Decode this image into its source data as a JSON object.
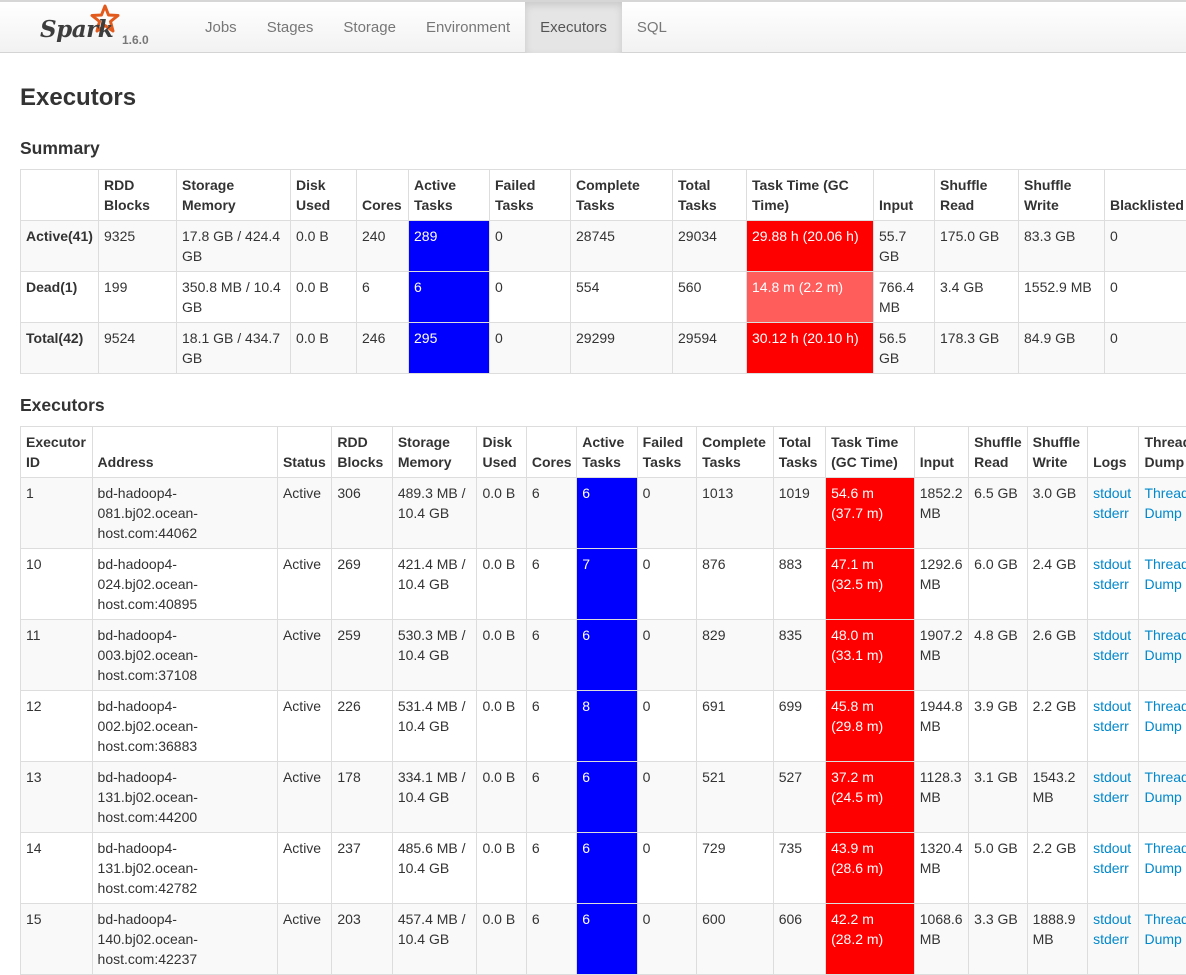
{
  "app": {
    "logo_text": "Spark",
    "version": "1.6.0",
    "star_color": "#e25a1c"
  },
  "nav": {
    "tabs": [
      "Jobs",
      "Stages",
      "Storage",
      "Environment",
      "Executors",
      "SQL"
    ],
    "active": "Executors"
  },
  "page": {
    "title": "Executors"
  },
  "summary": {
    "title": "Summary",
    "headers": [
      "",
      "RDD Blocks",
      "Storage Memory",
      "Disk Used",
      "Cores",
      "Active Tasks",
      "Failed Tasks",
      "Complete Tasks",
      "Total Tasks",
      "Task Time (GC Time)",
      "Input",
      "Shuffle Read",
      "Shuffle Write",
      "Blacklisted"
    ],
    "rows": [
      {
        "label": "Active(41)",
        "rdd_blocks": "9325",
        "storage_memory": "17.8 GB / 424.4 GB",
        "disk_used": "0.0 B",
        "cores": "240",
        "active_tasks": "289",
        "failed_tasks": "0",
        "complete_tasks": "28745",
        "total_tasks": "29034",
        "task_time": "29.88 h (20.06 h)",
        "input": "55.7 GB",
        "shuffle_read": "175.0 GB",
        "shuffle_write": "83.3 GB",
        "blacklisted": "0"
      },
      {
        "label": "Dead(1)",
        "rdd_blocks": "199",
        "storage_memory": "350.8 MB / 10.4 GB",
        "disk_used": "0.0 B",
        "cores": "6",
        "active_tasks": "6",
        "failed_tasks": "0",
        "complete_tasks": "554",
        "total_tasks": "560",
        "task_time": "14.8 m (2.2 m)",
        "input": "766.4 MB",
        "shuffle_read": "3.4 GB",
        "shuffle_write": "1552.9 MB",
        "blacklisted": "0"
      },
      {
        "label": "Total(42)",
        "rdd_blocks": "9524",
        "storage_memory": "18.1 GB / 434.7 GB",
        "disk_used": "0.0 B",
        "cores": "246",
        "active_tasks": "295",
        "failed_tasks": "0",
        "complete_tasks": "29299",
        "total_tasks": "29594",
        "task_time": "30.12 h (20.10 h)",
        "input": "56.5 GB",
        "shuffle_read": "178.3 GB",
        "shuffle_write": "84.9 GB",
        "blacklisted": "0"
      }
    ]
  },
  "executors": {
    "title": "Executors",
    "headers": [
      "Executor ID",
      "Address",
      "Status",
      "RDD Blocks",
      "Storage Memory",
      "Disk Used",
      "Cores",
      "Active Tasks",
      "Failed Tasks",
      "Complete Tasks",
      "Total Tasks",
      "Task Time (GC Time)",
      "Input",
      "Shuffle Read",
      "Shuffle Write",
      "Logs",
      "Thread Dump"
    ],
    "log_labels": [
      "stdout",
      "stderr"
    ],
    "thread_dump_label": "Thread Dump",
    "rows": [
      {
        "id": "1",
        "address": "bd-hadoop4-081.bj02.ocean-host.com:44062",
        "status": "Active",
        "rdd_blocks": "306",
        "storage_memory": "489.3 MB / 10.4 GB",
        "disk_used": "0.0 B",
        "cores": "6",
        "active_tasks": "6",
        "failed_tasks": "0",
        "complete_tasks": "1013",
        "total_tasks": "1019",
        "task_time": "54.6 m (37.7 m)",
        "input": "1852.2 MB",
        "shuffle_read": "6.5 GB",
        "shuffle_write": "3.0 GB"
      },
      {
        "id": "10",
        "address": "bd-hadoop4-024.bj02.ocean-host.com:40895",
        "status": "Active",
        "rdd_blocks": "269",
        "storage_memory": "421.4 MB / 10.4 GB",
        "disk_used": "0.0 B",
        "cores": "6",
        "active_tasks": "7",
        "failed_tasks": "0",
        "complete_tasks": "876",
        "total_tasks": "883",
        "task_time": "47.1 m (32.5 m)",
        "input": "1292.6 MB",
        "shuffle_read": "6.0 GB",
        "shuffle_write": "2.4 GB"
      },
      {
        "id": "11",
        "address": "bd-hadoop4-003.bj02.ocean-host.com:37108",
        "status": "Active",
        "rdd_blocks": "259",
        "storage_memory": "530.3 MB / 10.4 GB",
        "disk_used": "0.0 B",
        "cores": "6",
        "active_tasks": "6",
        "failed_tasks": "0",
        "complete_tasks": "829",
        "total_tasks": "835",
        "task_time": "48.0 m (33.1 m)",
        "input": "1907.2 MB",
        "shuffle_read": "4.8 GB",
        "shuffle_write": "2.6 GB"
      },
      {
        "id": "12",
        "address": "bd-hadoop4-002.bj02.ocean-host.com:36883",
        "status": "Active",
        "rdd_blocks": "226",
        "storage_memory": "531.4 MB / 10.4 GB",
        "disk_used": "0.0 B",
        "cores": "6",
        "active_tasks": "8",
        "failed_tasks": "0",
        "complete_tasks": "691",
        "total_tasks": "699",
        "task_time": "45.8 m (29.8 m)",
        "input": "1944.8 MB",
        "shuffle_read": "3.9 GB",
        "shuffle_write": "2.2 GB"
      },
      {
        "id": "13",
        "address": "bd-hadoop4-131.bj02.ocean-host.com:44200",
        "status": "Active",
        "rdd_blocks": "178",
        "storage_memory": "334.1 MB / 10.4 GB",
        "disk_used": "0.0 B",
        "cores": "6",
        "active_tasks": "6",
        "failed_tasks": "0",
        "complete_tasks": "521",
        "total_tasks": "527",
        "task_time": "37.2 m (24.5 m)",
        "input": "1128.3 MB",
        "shuffle_read": "3.1 GB",
        "shuffle_write": "1543.2 MB"
      },
      {
        "id": "14",
        "address": "bd-hadoop4-131.bj02.ocean-host.com:42782",
        "status": "Active",
        "rdd_blocks": "237",
        "storage_memory": "485.6 MB / 10.4 GB",
        "disk_used": "0.0 B",
        "cores": "6",
        "active_tasks": "6",
        "failed_tasks": "0",
        "complete_tasks": "729",
        "total_tasks": "735",
        "task_time": "43.9 m (28.6 m)",
        "input": "1320.4 MB",
        "shuffle_read": "5.0 GB",
        "shuffle_write": "2.2 GB"
      },
      {
        "id": "15",
        "address": "bd-hadoop4-140.bj02.ocean-host.com:42237",
        "status": "Active",
        "rdd_blocks": "203",
        "storage_memory": "457.4 MB / 10.4 GB",
        "disk_used": "0.0 B",
        "cores": "6",
        "active_tasks": "6",
        "failed_tasks": "0",
        "complete_tasks": "600",
        "total_tasks": "606",
        "task_time": "42.2 m (28.2 m)",
        "input": "1068.6 MB",
        "shuffle_read": "3.3 GB",
        "shuffle_write": "1888.9 MB"
      }
    ]
  }
}
